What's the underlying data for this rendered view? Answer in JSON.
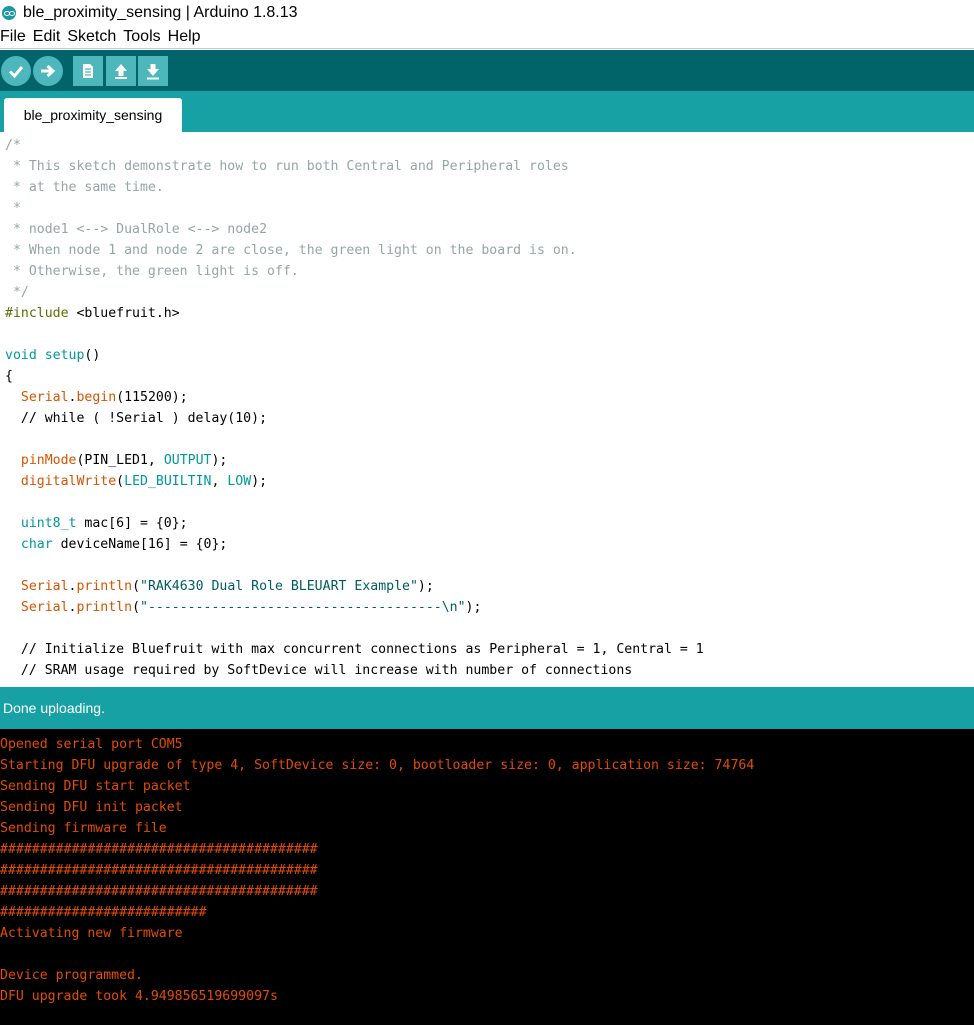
{
  "window": {
    "title": "ble_proximity_sensing | Arduino 1.8.13"
  },
  "menu": [
    "File",
    "Edit",
    "Sketch",
    "Tools",
    "Help"
  ],
  "toolbar": {
    "buttons": [
      {
        "name": "verify",
        "icon": "checkmark-icon"
      },
      {
        "name": "upload",
        "icon": "arrow-right-icon"
      },
      {
        "name": "new",
        "icon": "document-icon"
      },
      {
        "name": "open",
        "icon": "arrow-up-icon"
      },
      {
        "name": "save",
        "icon": "arrow-down-icon"
      }
    ],
    "colors": {
      "bar": "#006468",
      "button": "#4db7bb"
    }
  },
  "tab": {
    "label": "ble_proximity_sensing"
  },
  "code": [
    [
      {
        "t": "/*",
        "c": "comment"
      }
    ],
    [
      {
        "t": " * This sketch demonstrate how to run both Central and Peripheral roles",
        "c": "comment"
      }
    ],
    [
      {
        "t": " * at the same time.",
        "c": "comment"
      }
    ],
    [
      {
        "t": " *",
        "c": "comment"
      }
    ],
    [
      {
        "t": " * node1 <--> DualRole <--> node2",
        "c": "comment"
      }
    ],
    [
      {
        "t": " * When node 1 and node 2 are close, the green light on the board is on.",
        "c": "comment"
      }
    ],
    [
      {
        "t": " * Otherwise, the green light is off.",
        "c": "comment"
      }
    ],
    [
      {
        "t": " */",
        "c": "comment"
      }
    ],
    [
      {
        "t": "#include",
        "c": "include"
      },
      {
        "t": " <bluefruit.h>",
        "c": "plain"
      }
    ],
    [],
    [
      {
        "t": "void",
        "c": "type"
      },
      {
        "t": " ",
        "c": "plain"
      },
      {
        "t": "setup",
        "c": "type"
      },
      {
        "t": "()",
        "c": "plain"
      }
    ],
    [
      {
        "t": "{",
        "c": "plain"
      }
    ],
    [
      {
        "t": "  ",
        "c": "plain"
      },
      {
        "t": "Serial",
        "c": "fn"
      },
      {
        "t": ".",
        "c": "plain"
      },
      {
        "t": "begin",
        "c": "fn"
      },
      {
        "t": "(115200);",
        "c": "plain"
      }
    ],
    [
      {
        "t": "  // while ( !Serial ) delay(10);",
        "c": "plain"
      }
    ],
    [],
    [
      {
        "t": "  ",
        "c": "plain"
      },
      {
        "t": "pinMode",
        "c": "fn"
      },
      {
        "t": "(PIN_LED1, ",
        "c": "plain"
      },
      {
        "t": "OUTPUT",
        "c": "type"
      },
      {
        "t": ");",
        "c": "plain"
      }
    ],
    [
      {
        "t": "  ",
        "c": "plain"
      },
      {
        "t": "digitalWrite",
        "c": "fn"
      },
      {
        "t": "(",
        "c": "plain"
      },
      {
        "t": "LED_BUILTIN",
        "c": "type"
      },
      {
        "t": ", ",
        "c": "plain"
      },
      {
        "t": "LOW",
        "c": "type"
      },
      {
        "t": ");",
        "c": "plain"
      }
    ],
    [],
    [
      {
        "t": "  ",
        "c": "plain"
      },
      {
        "t": "uint8_t",
        "c": "type"
      },
      {
        "t": " mac[6] = {0};",
        "c": "plain"
      }
    ],
    [
      {
        "t": "  ",
        "c": "plain"
      },
      {
        "t": "char",
        "c": "type"
      },
      {
        "t": " deviceName[16] = {0};",
        "c": "plain"
      }
    ],
    [],
    [
      {
        "t": "  ",
        "c": "plain"
      },
      {
        "t": "Serial",
        "c": "fn"
      },
      {
        "t": ".",
        "c": "plain"
      },
      {
        "t": "println",
        "c": "fn"
      },
      {
        "t": "(",
        "c": "plain"
      },
      {
        "t": "\"RAK4630 Dual Role BLEUART Example\"",
        "c": "str"
      },
      {
        "t": ");",
        "c": "plain"
      }
    ],
    [
      {
        "t": "  ",
        "c": "plain"
      },
      {
        "t": "Serial",
        "c": "fn"
      },
      {
        "t": ".",
        "c": "plain"
      },
      {
        "t": "println",
        "c": "fn"
      },
      {
        "t": "(",
        "c": "plain"
      },
      {
        "t": "\"-------------------------------------\\n\"",
        "c": "str"
      },
      {
        "t": ");",
        "c": "plain"
      }
    ],
    [],
    [
      {
        "t": "  // Initialize Bluefruit with max concurrent connections as Peripheral = 1, Central = 1",
        "c": "plain"
      }
    ],
    [
      {
        "t": "  // SRAM usage required by SoftDevice will increase with number of connections",
        "c": "plain"
      }
    ]
  ],
  "status": {
    "message": "Done uploading."
  },
  "console": [
    "Opened serial port COM5",
    "Starting DFU upgrade of type 4, SoftDevice size: 0, bootloader size: 0, application size: 74764",
    "Sending DFU start packet",
    "Sending DFU init packet",
    "Sending firmware file",
    "########################################",
    "########################################",
    "########################################",
    "##########################",
    "Activating new firmware",
    "",
    "Device programmed.",
    "DFU upgrade took 4.949856519699097s"
  ],
  "colors": {
    "toolbar": "#006468",
    "accent": "#17a1a5",
    "console_text": "#e34c00",
    "comment": "#95a5a6",
    "keyword": "#00979c",
    "function": "#d35400"
  }
}
